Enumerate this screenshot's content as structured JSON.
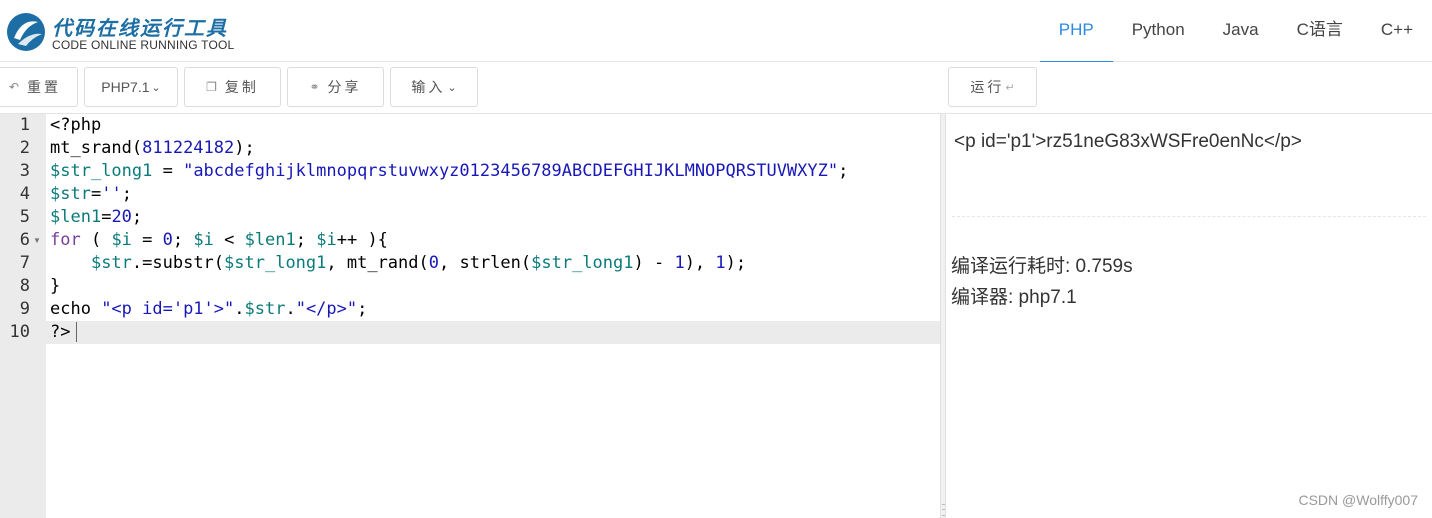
{
  "logo": {
    "cn": "代码在线运行工具",
    "en": "CODE ONLINE RUNNING TOOL"
  },
  "lang_tabs": [
    {
      "label": "PHP",
      "active": true
    },
    {
      "label": "Python",
      "active": false
    },
    {
      "label": "Java",
      "active": false
    },
    {
      "label": "C语言",
      "active": false
    },
    {
      "label": "C++",
      "active": false
    }
  ],
  "toolbar": {
    "reset_label": "重置",
    "version_label": "PHP7.1",
    "copy_label": "复制",
    "share_label": "分享",
    "input_label": "输入",
    "run_label": "运行"
  },
  "editor": {
    "line_numbers": [
      "1",
      "2",
      "3",
      "4",
      "5",
      "6",
      "7",
      "8",
      "9",
      "10"
    ],
    "lines": [
      [
        {
          "t": "<?php",
          "c": "plain"
        }
      ],
      [
        {
          "t": "mt_srand(",
          "c": "plain"
        },
        {
          "t": "811224182",
          "c": "num"
        },
        {
          "t": ");",
          "c": "plain"
        }
      ],
      [
        {
          "t": "$str_long1",
          "c": "var"
        },
        {
          "t": " = ",
          "c": "plain"
        },
        {
          "t": "\"abcdefghijklmnopqrstuvwxyz0123456789ABCDEFGHIJKLMNOPQRSTUVWXYZ\"",
          "c": "str"
        },
        {
          "t": ";",
          "c": "plain"
        }
      ],
      [
        {
          "t": "$str",
          "c": "var"
        },
        {
          "t": "=",
          "c": "plain"
        },
        {
          "t": "''",
          "c": "str"
        },
        {
          "t": ";",
          "c": "plain"
        }
      ],
      [
        {
          "t": "$len1",
          "c": "var"
        },
        {
          "t": "=",
          "c": "plain"
        },
        {
          "t": "20",
          "c": "num"
        },
        {
          "t": ";",
          "c": "plain"
        }
      ],
      [
        {
          "t": "for",
          "c": "kw"
        },
        {
          "t": " ( ",
          "c": "plain"
        },
        {
          "t": "$i",
          "c": "var"
        },
        {
          "t": " = ",
          "c": "plain"
        },
        {
          "t": "0",
          "c": "num"
        },
        {
          "t": "; ",
          "c": "plain"
        },
        {
          "t": "$i",
          "c": "var"
        },
        {
          "t": " < ",
          "c": "plain"
        },
        {
          "t": "$len1",
          "c": "var"
        },
        {
          "t": "; ",
          "c": "plain"
        },
        {
          "t": "$i",
          "c": "var"
        },
        {
          "t": "++ ){",
          "c": "plain"
        }
      ],
      [
        {
          "t": "    ",
          "c": "plain"
        },
        {
          "t": "$str",
          "c": "var"
        },
        {
          "t": ".=substr(",
          "c": "plain"
        },
        {
          "t": "$str_long1",
          "c": "var"
        },
        {
          "t": ", mt_rand(",
          "c": "plain"
        },
        {
          "t": "0",
          "c": "num"
        },
        {
          "t": ", strlen(",
          "c": "plain"
        },
        {
          "t": "$str_long1",
          "c": "var"
        },
        {
          "t": ") - ",
          "c": "plain"
        },
        {
          "t": "1",
          "c": "num"
        },
        {
          "t": "), ",
          "c": "plain"
        },
        {
          "t": "1",
          "c": "num"
        },
        {
          "t": ");",
          "c": "plain"
        }
      ],
      [
        {
          "t": "}",
          "c": "plain"
        }
      ],
      [
        {
          "t": "echo ",
          "c": "plain"
        },
        {
          "t": "\"<p id='p1'>\"",
          "c": "str"
        },
        {
          "t": ".",
          "c": "plain"
        },
        {
          "t": "$str",
          "c": "var"
        },
        {
          "t": ".",
          "c": "plain"
        },
        {
          "t": "\"</p>\"",
          "c": "str"
        },
        {
          "t": ";",
          "c": "plain"
        }
      ],
      [
        {
          "t": "?>",
          "c": "plain"
        }
      ]
    ]
  },
  "output": {
    "html": "<p id='p1'>rz51neG83xWSFre0enNc</p>",
    "time_text": "编译运行耗时: 0.759s",
    "compiler_text": "编译器: php7.1"
  },
  "watermark": "CSDN @Wolffy007",
  "colors": {
    "accent": "#2d8ae0",
    "keyword": "#7a3e9d",
    "variable": "#0b7a7a",
    "number": "#1818b8",
    "string": "#1818b8"
  }
}
